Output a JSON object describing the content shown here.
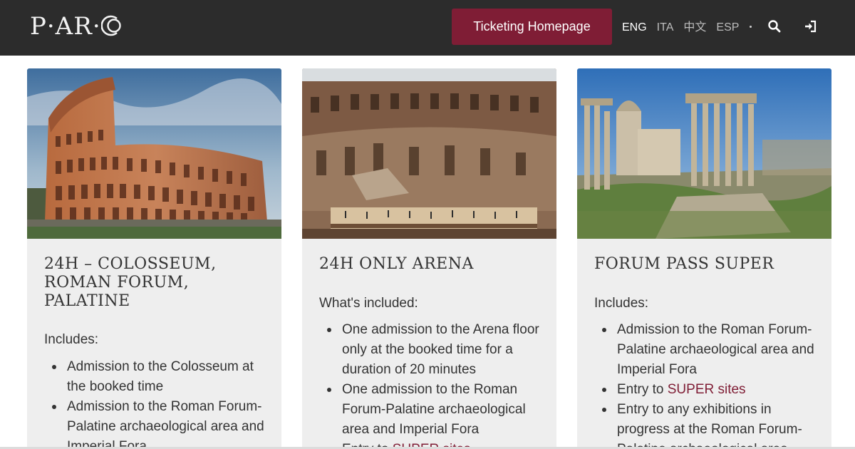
{
  "header": {
    "logo_left": "P·AR·",
    "ticketing_button": "Ticketing Homepage",
    "languages": [
      {
        "code": "ENG",
        "active": true
      },
      {
        "code": "ITA",
        "active": false
      },
      {
        "code": "中文",
        "active": false
      },
      {
        "code": "ESP",
        "active": false
      }
    ],
    "icons": [
      "search-icon",
      "login-icon"
    ]
  },
  "cards": [
    {
      "title": "24H – COLOSSEUM, ROMAN FORUM, PALATINE",
      "subheading": "Includes:",
      "items": [
        {
          "text": "Admission to the Colosseum at the booked time"
        },
        {
          "text": "Admission to the Roman Forum-Palatine archaeological area and Imperial Fora"
        }
      ]
    },
    {
      "title": "24H ONLY ARENA",
      "subheading": "What's included:",
      "items": [
        {
          "text": "One admission to the Arena floor only at the booked time for a duration of 20 minutes"
        },
        {
          "text": "One admission to the Roman Forum-Palatine archaeological area and Imperial Fora"
        },
        {
          "pre": "Entry to ",
          "link": "SUPER sites"
        }
      ]
    },
    {
      "title": "FORUM PASS SUPER",
      "subheading": "Includes:",
      "items": [
        {
          "text": "Admission to the Roman Forum-Palatine archaeological area and Imperial Fora"
        },
        {
          "pre": "Entry to ",
          "link": "SUPER sites"
        },
        {
          "text": "Entry to any exhibitions in progress at the Roman Forum-Palatine archaeological area"
        }
      ]
    }
  ],
  "colors": {
    "header_bg": "#2c2c2c",
    "accent": "#7f1d35",
    "card_bg": "#eeeeee"
  }
}
